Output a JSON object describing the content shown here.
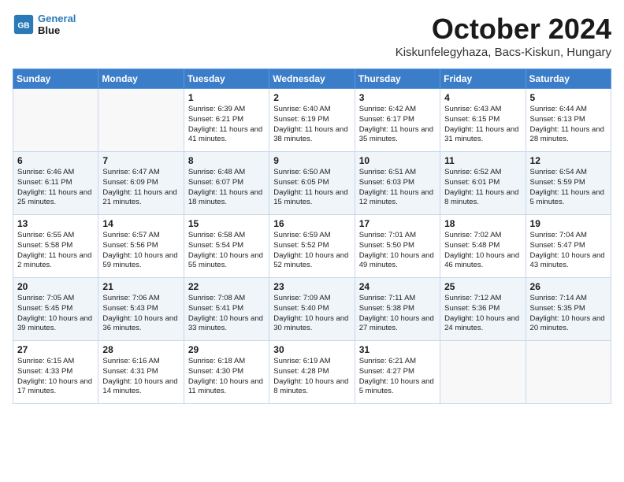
{
  "header": {
    "logo_line1": "General",
    "logo_line2": "Blue",
    "month": "October 2024",
    "location": "Kiskunfelegyhaza, Bacs-Kiskun, Hungary"
  },
  "weekdays": [
    "Sunday",
    "Monday",
    "Tuesday",
    "Wednesday",
    "Thursday",
    "Friday",
    "Saturday"
  ],
  "weeks": [
    [
      {
        "day": "",
        "sunrise": "",
        "sunset": "",
        "daylight": ""
      },
      {
        "day": "",
        "sunrise": "",
        "sunset": "",
        "daylight": ""
      },
      {
        "day": "1",
        "sunrise": "Sunrise: 6:39 AM",
        "sunset": "Sunset: 6:21 PM",
        "daylight": "Daylight: 11 hours and 41 minutes."
      },
      {
        "day": "2",
        "sunrise": "Sunrise: 6:40 AM",
        "sunset": "Sunset: 6:19 PM",
        "daylight": "Daylight: 11 hours and 38 minutes."
      },
      {
        "day": "3",
        "sunrise": "Sunrise: 6:42 AM",
        "sunset": "Sunset: 6:17 PM",
        "daylight": "Daylight: 11 hours and 35 minutes."
      },
      {
        "day": "4",
        "sunrise": "Sunrise: 6:43 AM",
        "sunset": "Sunset: 6:15 PM",
        "daylight": "Daylight: 11 hours and 31 minutes."
      },
      {
        "day": "5",
        "sunrise": "Sunrise: 6:44 AM",
        "sunset": "Sunset: 6:13 PM",
        "daylight": "Daylight: 11 hours and 28 minutes."
      }
    ],
    [
      {
        "day": "6",
        "sunrise": "Sunrise: 6:46 AM",
        "sunset": "Sunset: 6:11 PM",
        "daylight": "Daylight: 11 hours and 25 minutes."
      },
      {
        "day": "7",
        "sunrise": "Sunrise: 6:47 AM",
        "sunset": "Sunset: 6:09 PM",
        "daylight": "Daylight: 11 hours and 21 minutes."
      },
      {
        "day": "8",
        "sunrise": "Sunrise: 6:48 AM",
        "sunset": "Sunset: 6:07 PM",
        "daylight": "Daylight: 11 hours and 18 minutes."
      },
      {
        "day": "9",
        "sunrise": "Sunrise: 6:50 AM",
        "sunset": "Sunset: 6:05 PM",
        "daylight": "Daylight: 11 hours and 15 minutes."
      },
      {
        "day": "10",
        "sunrise": "Sunrise: 6:51 AM",
        "sunset": "Sunset: 6:03 PM",
        "daylight": "Daylight: 11 hours and 12 minutes."
      },
      {
        "day": "11",
        "sunrise": "Sunrise: 6:52 AM",
        "sunset": "Sunset: 6:01 PM",
        "daylight": "Daylight: 11 hours and 8 minutes."
      },
      {
        "day": "12",
        "sunrise": "Sunrise: 6:54 AM",
        "sunset": "Sunset: 5:59 PM",
        "daylight": "Daylight: 11 hours and 5 minutes."
      }
    ],
    [
      {
        "day": "13",
        "sunrise": "Sunrise: 6:55 AM",
        "sunset": "Sunset: 5:58 PM",
        "daylight": "Daylight: 11 hours and 2 minutes."
      },
      {
        "day": "14",
        "sunrise": "Sunrise: 6:57 AM",
        "sunset": "Sunset: 5:56 PM",
        "daylight": "Daylight: 10 hours and 59 minutes."
      },
      {
        "day": "15",
        "sunrise": "Sunrise: 6:58 AM",
        "sunset": "Sunset: 5:54 PM",
        "daylight": "Daylight: 10 hours and 55 minutes."
      },
      {
        "day": "16",
        "sunrise": "Sunrise: 6:59 AM",
        "sunset": "Sunset: 5:52 PM",
        "daylight": "Daylight: 10 hours and 52 minutes."
      },
      {
        "day": "17",
        "sunrise": "Sunrise: 7:01 AM",
        "sunset": "Sunset: 5:50 PM",
        "daylight": "Daylight: 10 hours and 49 minutes."
      },
      {
        "day": "18",
        "sunrise": "Sunrise: 7:02 AM",
        "sunset": "Sunset: 5:48 PM",
        "daylight": "Daylight: 10 hours and 46 minutes."
      },
      {
        "day": "19",
        "sunrise": "Sunrise: 7:04 AM",
        "sunset": "Sunset: 5:47 PM",
        "daylight": "Daylight: 10 hours and 43 minutes."
      }
    ],
    [
      {
        "day": "20",
        "sunrise": "Sunrise: 7:05 AM",
        "sunset": "Sunset: 5:45 PM",
        "daylight": "Daylight: 10 hours and 39 minutes."
      },
      {
        "day": "21",
        "sunrise": "Sunrise: 7:06 AM",
        "sunset": "Sunset: 5:43 PM",
        "daylight": "Daylight: 10 hours and 36 minutes."
      },
      {
        "day": "22",
        "sunrise": "Sunrise: 7:08 AM",
        "sunset": "Sunset: 5:41 PM",
        "daylight": "Daylight: 10 hours and 33 minutes."
      },
      {
        "day": "23",
        "sunrise": "Sunrise: 7:09 AM",
        "sunset": "Sunset: 5:40 PM",
        "daylight": "Daylight: 10 hours and 30 minutes."
      },
      {
        "day": "24",
        "sunrise": "Sunrise: 7:11 AM",
        "sunset": "Sunset: 5:38 PM",
        "daylight": "Daylight: 10 hours and 27 minutes."
      },
      {
        "day": "25",
        "sunrise": "Sunrise: 7:12 AM",
        "sunset": "Sunset: 5:36 PM",
        "daylight": "Daylight: 10 hours and 24 minutes."
      },
      {
        "day": "26",
        "sunrise": "Sunrise: 7:14 AM",
        "sunset": "Sunset: 5:35 PM",
        "daylight": "Daylight: 10 hours and 20 minutes."
      }
    ],
    [
      {
        "day": "27",
        "sunrise": "Sunrise: 6:15 AM",
        "sunset": "Sunset: 4:33 PM",
        "daylight": "Daylight: 10 hours and 17 minutes."
      },
      {
        "day": "28",
        "sunrise": "Sunrise: 6:16 AM",
        "sunset": "Sunset: 4:31 PM",
        "daylight": "Daylight: 10 hours and 14 minutes."
      },
      {
        "day": "29",
        "sunrise": "Sunrise: 6:18 AM",
        "sunset": "Sunset: 4:30 PM",
        "daylight": "Daylight: 10 hours and 11 minutes."
      },
      {
        "day": "30",
        "sunrise": "Sunrise: 6:19 AM",
        "sunset": "Sunset: 4:28 PM",
        "daylight": "Daylight: 10 hours and 8 minutes."
      },
      {
        "day": "31",
        "sunrise": "Sunrise: 6:21 AM",
        "sunset": "Sunset: 4:27 PM",
        "daylight": "Daylight: 10 hours and 5 minutes."
      },
      {
        "day": "",
        "sunrise": "",
        "sunset": "",
        "daylight": ""
      },
      {
        "day": "",
        "sunrise": "",
        "sunset": "",
        "daylight": ""
      }
    ]
  ]
}
